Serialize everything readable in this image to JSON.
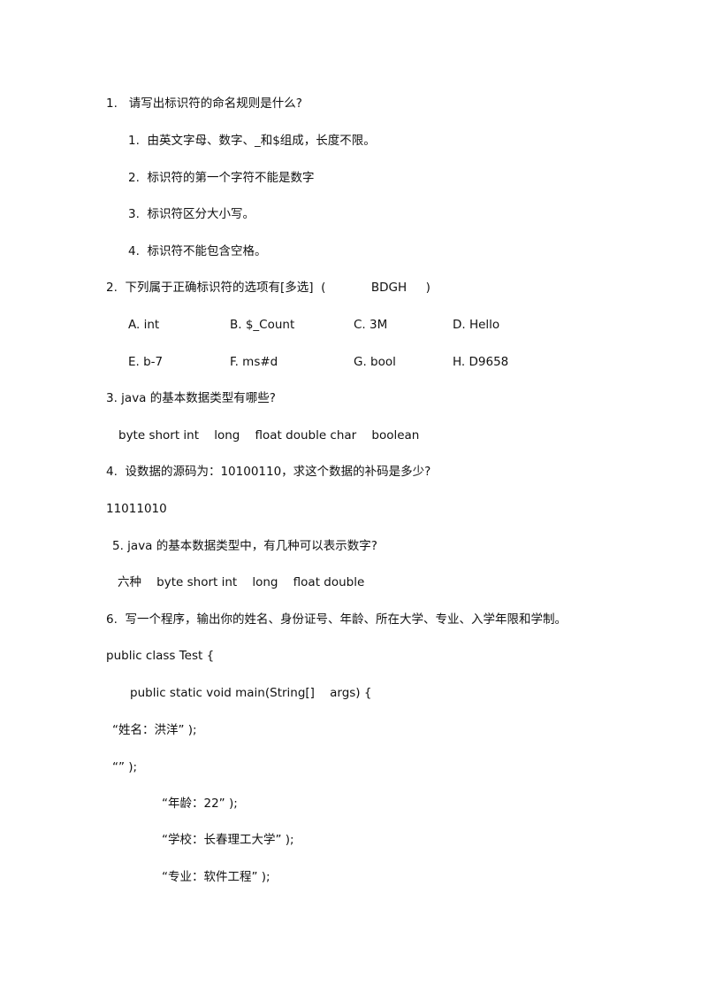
{
  "document": {
    "q1": {
      "title": "1.   请写出标识符的命名规则是什么?",
      "rules": [
        "1.  由英文字母、数字、_和$组成，长度不限。",
        "2.  标识符的第一个字符不能是数字",
        "3.  标识符区分大小写。",
        "4.  标识符不能包含空格。"
      ]
    },
    "q2": {
      "title": "2.  下列属于正确标识符的选项有[多选]  (            BDGH     )",
      "options": [
        [
          "A. int",
          "B. $_Count",
          "C. 3M",
          "D. Hello"
        ],
        [
          "E. b-7",
          "F. ms#d",
          "G. bool",
          "H. D9658"
        ]
      ]
    },
    "q3": {
      "title": "3. java 的基本数据类型有哪些?",
      "answer": "byte short int    long    float double char    boolean"
    },
    "q4": {
      "title": "4.  设数据的源码为：10100110，求这个数据的补码是多少?",
      "answer": "11011010"
    },
    "q5": {
      "title": "5. java 的基本数据类型中，有几种可以表示数字?",
      "answer": "六种    byte short int    long    float double"
    },
    "q6": {
      "title": "6.  写一个程序，输出你的姓名、身份证号、年龄、所在大学、专业、入学年限和学制。",
      "code": [
        "public class Test {",
        "public static void main(String[]    args) {",
        "“姓名：洪洋” );",
        "“” );",
        "“年龄：22” );",
        "“学校：长春理工大学” );",
        "“专业：软件工程” );"
      ]
    }
  }
}
